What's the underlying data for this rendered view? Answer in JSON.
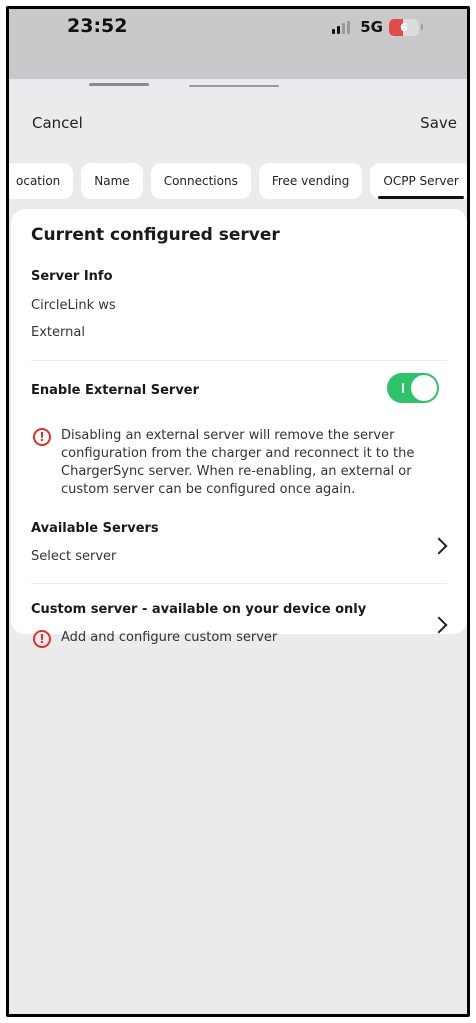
{
  "status_bar": {
    "time": "23:52",
    "network": "5G",
    "battery": "6",
    "colors": {
      "battery_low": "#e34a4a"
    }
  },
  "nav": {
    "cancel_label": "Cancel",
    "save_label": "Save"
  },
  "tabs": [
    {
      "label": "ocation",
      "active": false
    },
    {
      "label": "Name",
      "active": false
    },
    {
      "label": "Connections",
      "active": false
    },
    {
      "label": "Free vending",
      "active": false
    },
    {
      "label": "OCPP Server",
      "active": true
    }
  ],
  "card": {
    "title": "Current configured server",
    "server_info": {
      "heading": "Server Info",
      "name": "CircleLink ws",
      "type": "External"
    },
    "enable_external": {
      "label": "Enable External Server",
      "enabled": true,
      "toggle_color": "#2ec26b"
    },
    "warning": {
      "icon": "alert-circle-icon",
      "text": "Disabling an external server will remove the server configuration from the charger and reconnect it to the ChargerSync server. When re-enabling, an external or custom server can be configured once again."
    },
    "available_servers": {
      "heading": "Available Servers",
      "value": "Select server"
    },
    "custom_server": {
      "heading": "Custom server - available on your device only",
      "action": "Add and configure custom server"
    }
  }
}
